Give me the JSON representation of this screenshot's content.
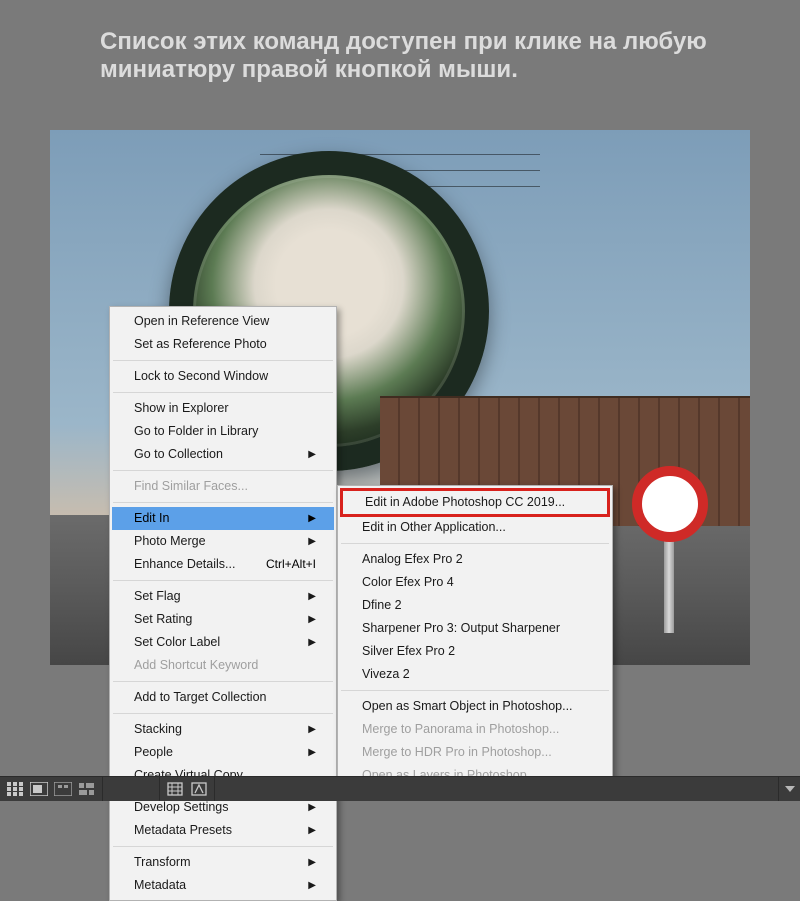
{
  "caption": "Список этих команд доступен при клике на любую миниатюру правой кнопкой мыши.",
  "menu": {
    "groups": [
      [
        {
          "label": "Open in Reference View"
        },
        {
          "label": "Set as Reference Photo"
        }
      ],
      [
        {
          "label": "Lock to Second Window"
        }
      ],
      [
        {
          "label": "Show in Explorer"
        },
        {
          "label": "Go to Folder in Library"
        },
        {
          "label": "Go to Collection",
          "submenu": true
        }
      ],
      [
        {
          "label": "Find Similar Faces...",
          "disabled": true
        }
      ],
      [
        {
          "label": "Edit In",
          "submenu": true,
          "highlight": true
        },
        {
          "label": "Photo Merge",
          "submenu": true
        },
        {
          "label": "Enhance Details...",
          "shortcut": "Ctrl+Alt+I"
        }
      ],
      [
        {
          "label": "Set Flag",
          "submenu": true
        },
        {
          "label": "Set Rating",
          "submenu": true
        },
        {
          "label": "Set Color Label",
          "submenu": true
        },
        {
          "label": "Add Shortcut Keyword",
          "disabled": true
        }
      ],
      [
        {
          "label": "Add to Target Collection"
        }
      ],
      [
        {
          "label": "Stacking",
          "submenu": true
        },
        {
          "label": "People",
          "submenu": true
        },
        {
          "label": "Create Virtual Copy"
        }
      ],
      [
        {
          "label": "Develop Settings",
          "submenu": true
        },
        {
          "label": "Metadata Presets",
          "submenu": true
        }
      ],
      [
        {
          "label": "Transform",
          "submenu": true
        },
        {
          "label": "Metadata",
          "submenu": true
        }
      ]
    ]
  },
  "submenu": {
    "groups": [
      [
        {
          "label": "Edit in Adobe Photoshop CC 2019...",
          "redbox": true
        },
        {
          "label": "Edit in Other Application..."
        }
      ],
      [
        {
          "label": "Analog Efex Pro 2"
        },
        {
          "label": "Color Efex Pro 4"
        },
        {
          "label": "Dfine 2"
        },
        {
          "label": "Sharpener Pro 3: Output Sharpener"
        },
        {
          "label": "Silver Efex Pro 2"
        },
        {
          "label": "Viveza 2"
        }
      ],
      [
        {
          "label": "Open as Smart Object in Photoshop..."
        },
        {
          "label": "Merge to Panorama in Photoshop...",
          "disabled": true
        },
        {
          "label": "Merge to HDR Pro in Photoshop...",
          "disabled": true
        },
        {
          "label": "Open as Layers in Photoshop...",
          "disabled": true
        }
      ]
    ]
  },
  "toolbar": {
    "icons": [
      "grid",
      "loupe",
      "compare",
      "survey"
    ]
  }
}
